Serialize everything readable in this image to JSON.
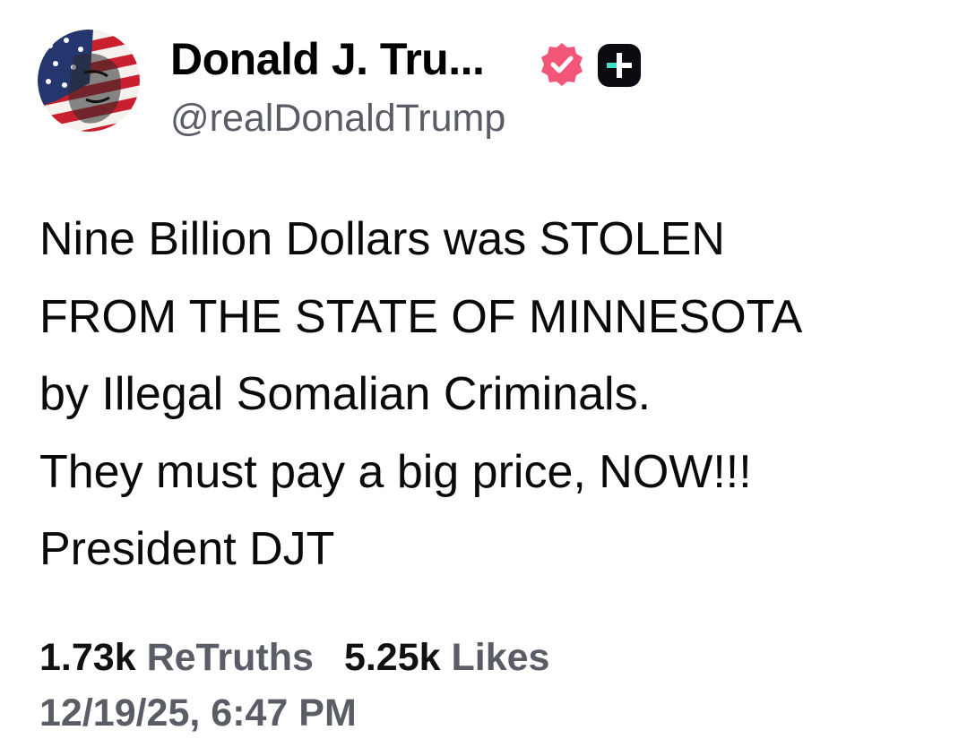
{
  "author": {
    "display_name": "Donald J. Tru...",
    "handle": "@realDonaldTrump",
    "avatar_icon": "flag-portrait-avatar",
    "verified_icon": "verified-badge-icon",
    "verified_color": "#f25577",
    "plus_icon": "truth-plus-icon"
  },
  "post": {
    "lines": [
      "Nine Billion Dollars was STOLEN",
      "FROM THE STATE OF MINNESOTA",
      "by Illegal Somalian Criminals.",
      "They must pay a big price, NOW!!!",
      "President DJT"
    ]
  },
  "stats": {
    "retruths_count": "1.73k",
    "retruths_label": "ReTruths",
    "likes_count": "5.25k",
    "likes_label": "Likes"
  },
  "timestamp": "12/19/25, 6:47 PM",
  "colors": {
    "text": "#0a0a0a",
    "muted": "#5a5c66",
    "flag_red": "#c8202e",
    "flag_blue": "#25356e"
  }
}
